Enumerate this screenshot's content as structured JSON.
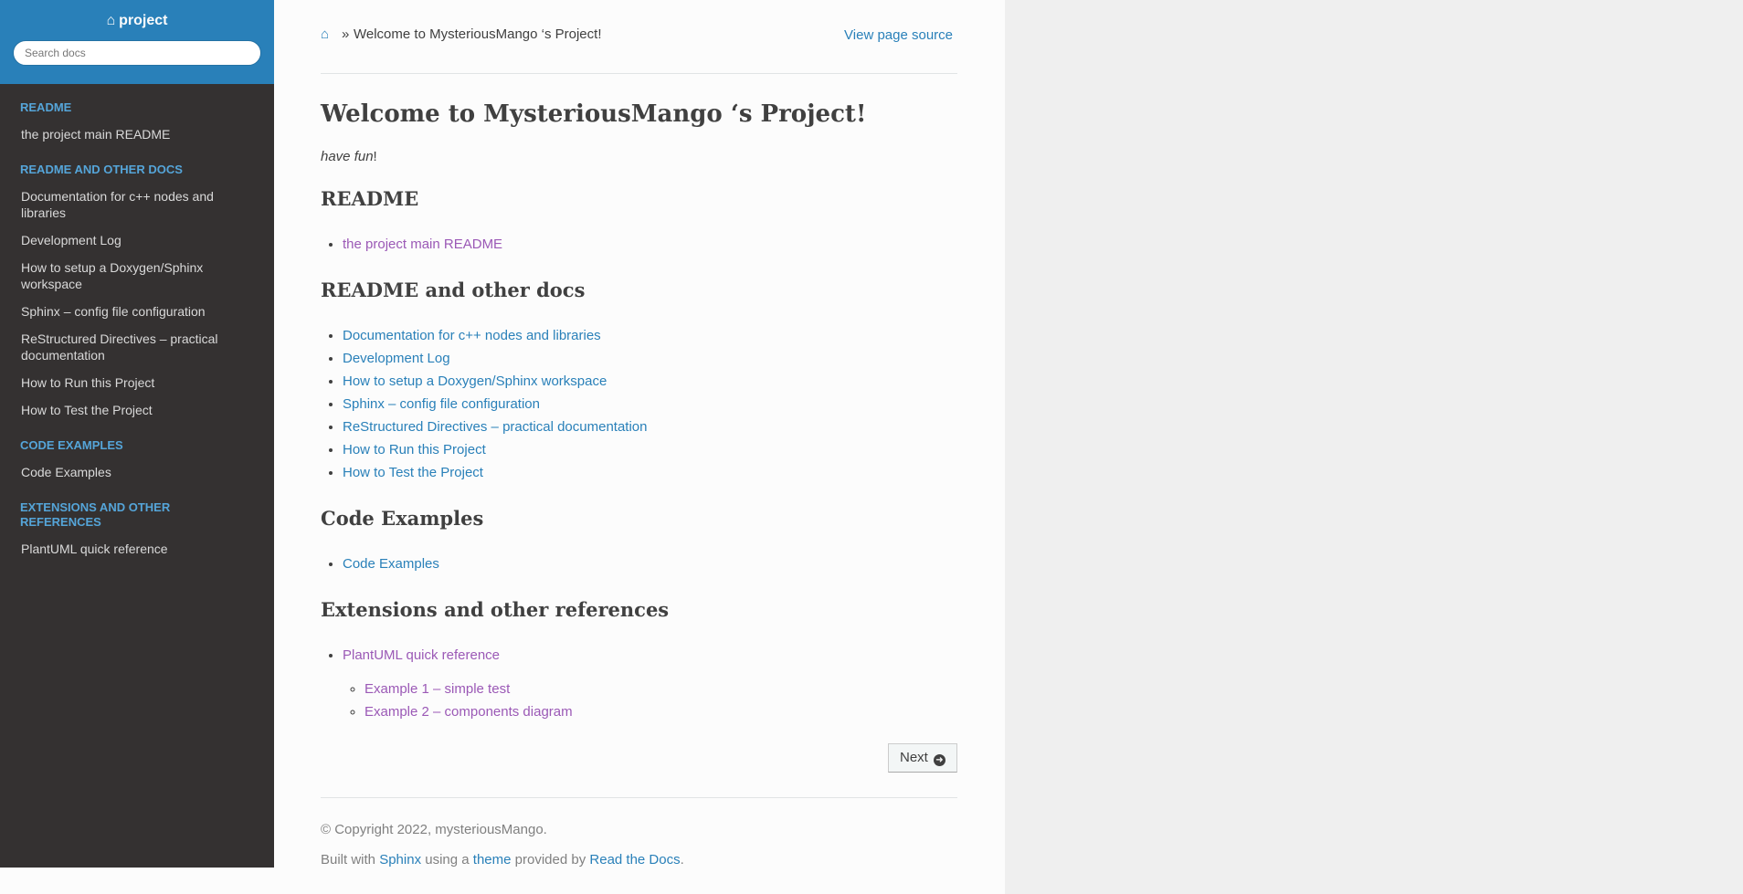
{
  "sidebar": {
    "project_name": "project",
    "home_glyph": "⌂",
    "search_placeholder": "Search docs",
    "sections": [
      {
        "caption": "README",
        "items": [
          "the project main README"
        ]
      },
      {
        "caption": "README and other docs",
        "items": [
          "Documentation for c++ nodes and libraries",
          "Development Log",
          "How to setup a Doxygen/Sphinx workspace",
          "Sphinx – config file configuration",
          "ReStructured Directives – practical documentation",
          "How to Run this Project",
          "How to Test the Project"
        ]
      },
      {
        "caption": "Code Examples",
        "items": [
          "Code Examples"
        ]
      },
      {
        "caption": "Extensions and other references",
        "items": [
          "PlantUML quick reference"
        ]
      }
    ]
  },
  "breadcrumbs": {
    "home_glyph": "⌂",
    "separator": "»",
    "current": "Welcome to MysteriousMango ‘s Project!",
    "view_source": "View page source"
  },
  "main": {
    "title": "Welcome to MysteriousMango ‘s Project!",
    "tagline_italic": "have fun",
    "tagline_end": "!",
    "sections": [
      {
        "heading": "README",
        "links": [
          "the project main README"
        ]
      },
      {
        "heading": "README and other docs",
        "links": [
          "Documentation for c++ nodes and libraries",
          "Development Log",
          "How to setup a Doxygen/Sphinx workspace",
          "Sphinx – config file configuration",
          "ReStructured Directives – practical documentation",
          "How to Run this Project",
          "How to Test the Project"
        ]
      },
      {
        "heading": "Code Examples",
        "links": [
          "Code Examples"
        ]
      },
      {
        "heading": "Extensions and other references",
        "links": [
          "PlantUML quick reference"
        ],
        "sublinks": [
          "Example 1 – simple test",
          "Example 2 – components diagram"
        ]
      }
    ],
    "next_label": "Next",
    "next_glyph": "➜"
  },
  "footer": {
    "copyright": "© Copyright 2022, mysteriousMango.",
    "built_prefix": "Built with ",
    "sphinx": "Sphinx",
    "using_a": " using a ",
    "theme": "theme",
    "provided_by": " provided by ",
    "rtd": "Read the Docs",
    "period": "."
  },
  "colors": {
    "sidebar_bg": "#343131",
    "sidebar_top_bg": "#2980b9",
    "caption": "#55a5d9",
    "link": "#2980b9",
    "visited_link": "#9b59b6"
  }
}
